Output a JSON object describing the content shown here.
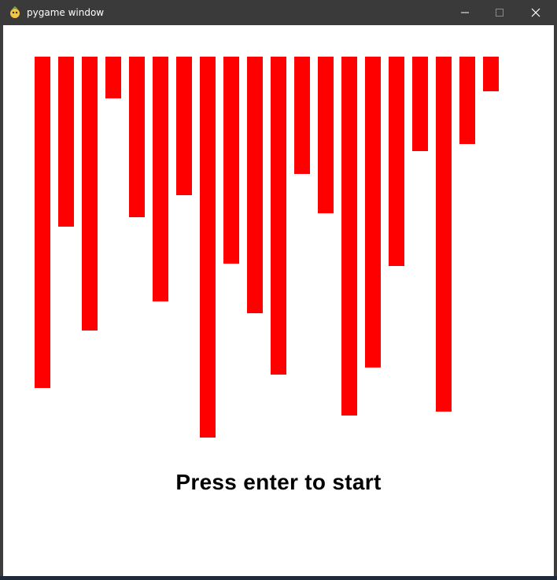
{
  "window": {
    "title": "pygame window",
    "app_icon": "pygame-snake-icon",
    "controls": {
      "minimize_icon": "minimize-icon",
      "maximize_icon": "maximize-icon",
      "close_icon": "close-icon"
    }
  },
  "game": {
    "prompt": "Press enter to start",
    "bar_color": "#ff0000",
    "background_color": "#ffffff",
    "bar_values": [
      421,
      216,
      348,
      53,
      204,
      311,
      176,
      484,
      263,
      326,
      404,
      149,
      199,
      456,
      395,
      266,
      120,
      451,
      111,
      44
    ]
  }
}
